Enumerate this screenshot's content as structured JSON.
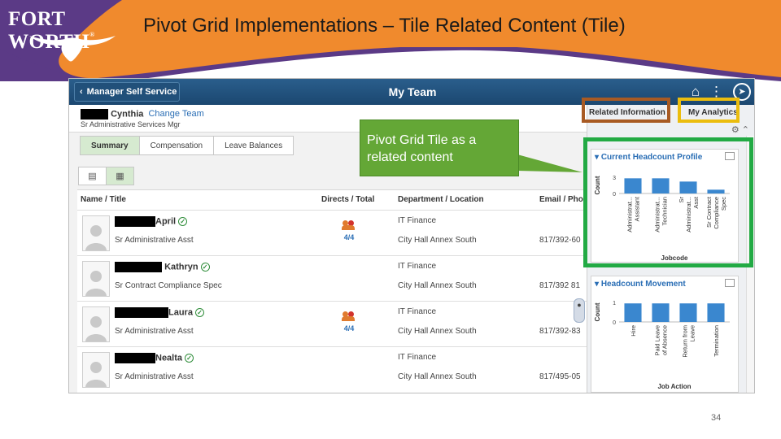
{
  "slide": {
    "title": "Pivot Grid Implementations – Tile Related Content (Tile)",
    "page_number": "34",
    "logo": "FORT WORTH",
    "logo_mark": "®",
    "colors": {
      "purple": "#5b3a86",
      "orange": "#f08a2d"
    }
  },
  "app": {
    "back_label": "Manager Self Service",
    "page_title": "My Team",
    "icons": [
      "home-icon",
      "more-icon",
      "navigator-icon"
    ],
    "user": {
      "name": "Cynthia",
      "change_link": "Change Team",
      "role": "Sr Administrative Services Mgr"
    },
    "tabs": [
      "Summary",
      "Compensation",
      "Leave Balances"
    ],
    "active_tab": "Summary",
    "grid": {
      "columns": [
        "Name / Title",
        "Directs / Total",
        "Department / Location",
        "Email / Pho"
      ],
      "rows": [
        {
          "name": "April",
          "title": "Sr Administrative Asst",
          "directs": "4/4",
          "dept": "IT Finance",
          "location": "City Hall Annex South",
          "phone": "817/392-60"
        },
        {
          "name": "Kathryn",
          "title": "Sr Contract Compliance Spec",
          "directs": "",
          "dept": "IT Finance",
          "location": "City Hall Annex South",
          "phone": "817/392 81"
        },
        {
          "name": "Laura",
          "title": "Sr Administrative Asst",
          "directs": "4/4",
          "dept": "IT Finance",
          "location": "City Hall Annex South",
          "phone": "817/392-83"
        },
        {
          "name": "Nealta",
          "title": "Sr Administrative Asst",
          "directs": "",
          "dept": "IT Finance",
          "location": "City Hall Annex South",
          "phone": "817/495-05"
        }
      ]
    },
    "related": {
      "tab_related": "Related Information",
      "tab_analytics": "My Analytics"
    }
  },
  "callout": {
    "text": "Pivot Grid Tile as a related content"
  },
  "chart_data": [
    {
      "type": "bar",
      "title": "Current Headcount Profile",
      "xlabel": "Jobcode",
      "ylabel": "Count",
      "categories": [
        "Administrat... Assistant",
        "Administrat... Technician",
        "Sr Administrat... Asst",
        "Sr Contract Compliance Spec"
      ],
      "values": [
        2.8,
        2.8,
        2.2,
        0.7
      ],
      "ylim": [
        0,
        3
      ],
      "yticks": [
        0,
        3
      ],
      "bar_color": "#3a87cf"
    },
    {
      "type": "bar",
      "title": "Headcount Movement",
      "xlabel": "Job Action",
      "ylabel": "Count",
      "categories": [
        "Hire",
        "Paid Leave of Absence",
        "Return from Leave",
        "Termination"
      ],
      "values": [
        0.95,
        0.95,
        0.95,
        0.95
      ],
      "ylim": [
        0,
        1
      ],
      "yticks": [
        0,
        1
      ],
      "bar_color": "#3a87cf"
    }
  ]
}
